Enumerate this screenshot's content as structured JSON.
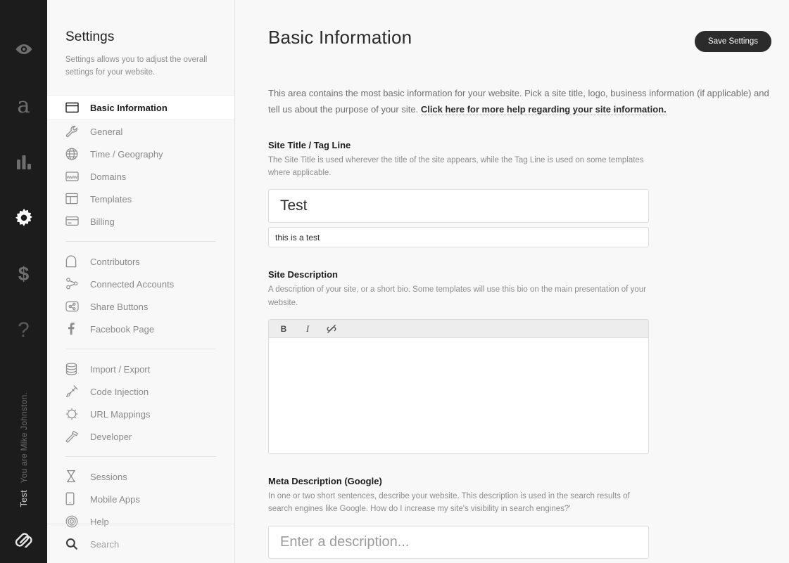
{
  "rail": {
    "top_items": [
      {
        "name": "preview-eye-icon",
        "icon": "eye-icon",
        "active": false
      },
      {
        "name": "design-icon",
        "icon": "letter-a-icon",
        "glyph": "a",
        "active": false
      },
      {
        "name": "metrics-icon",
        "icon": "bar-chart-icon",
        "active": false
      },
      {
        "name": "settings-icon",
        "icon": "gear-icon",
        "active": true
      },
      {
        "name": "commerce-icon",
        "icon": "dollar-icon",
        "glyph": "$",
        "active": false
      },
      {
        "name": "help-icon",
        "icon": "question-mark-icon",
        "glyph": "?",
        "active": false
      }
    ],
    "user_label": "You are Mike Johnston.",
    "site_label": "Test",
    "logo_name": "squarespace-logo"
  },
  "sidebar": {
    "title": "Settings",
    "subtitle": "Settings allows you to adjust the overall settings for your website.",
    "groups": [
      {
        "items": [
          {
            "label": "Basic Information",
            "icon": "window-icon",
            "active": true
          },
          {
            "label": "General",
            "icon": "wrench-icon",
            "active": false
          },
          {
            "label": "Time / Geography",
            "icon": "globe-icon",
            "active": false
          },
          {
            "label": "Domains",
            "icon": "www-icon",
            "active": false
          },
          {
            "label": "Templates",
            "icon": "layout-icon",
            "active": false
          },
          {
            "label": "Billing",
            "icon": "credit-card-icon",
            "active": false
          }
        ]
      },
      {
        "items": [
          {
            "label": "Contributors",
            "icon": "person-icon",
            "active": false
          },
          {
            "label": "Connected Accounts",
            "icon": "nodes-icon",
            "active": false
          },
          {
            "label": "Share Buttons",
            "icon": "share-icon",
            "active": false
          },
          {
            "label": "Facebook Page",
            "icon": "facebook-icon",
            "active": false
          }
        ]
      },
      {
        "items": [
          {
            "label": "Import / Export",
            "icon": "database-icon",
            "active": false
          },
          {
            "label": "Code Injection",
            "icon": "syringe-icon",
            "active": false
          },
          {
            "label": "URL Mappings",
            "icon": "sun-circle-icon",
            "active": false
          },
          {
            "label": "Developer",
            "icon": "hammer-icon",
            "active": false
          }
        ]
      },
      {
        "items": [
          {
            "label": "Sessions",
            "icon": "hourglass-icon",
            "active": false
          },
          {
            "label": "Mobile Apps",
            "icon": "mobile-phone-icon",
            "active": false
          },
          {
            "label": "Help",
            "icon": "lifesaver-icon",
            "active": false
          }
        ]
      }
    ],
    "search_label": "Search"
  },
  "main": {
    "page_title": "Basic Information",
    "save_label": "Save Settings",
    "intro_text": "This area contains the most basic information for your website. Pick a site title, logo, business information (if applicable) and tell us about the purpose of your site. ",
    "intro_link": "Click here for more help regarding your site information.",
    "fields": {
      "site_title": {
        "label": "Site Title / Tag Line",
        "description": "The Site Title is used wherever the title of the site appears, while the Tag Line is used on some templates where applicable.",
        "title_value": "Test",
        "title_placeholder": "",
        "tagline_value": "this is a test",
        "tagline_placeholder": ""
      },
      "site_description": {
        "label": "Site Description",
        "description": "A description of your site, or a short bio. Some templates will use this bio on the main presentation of your website.",
        "toolbar": [
          {
            "name": "bold-button",
            "label": "B"
          },
          {
            "name": "italic-button",
            "label": "I"
          },
          {
            "name": "unlink-button",
            "label": ""
          }
        ],
        "value": "",
        "placeholder": ""
      },
      "meta_description": {
        "label": "Meta Description (Google)",
        "description": "In one or two short sentences, describe your website. This description is used in the search results of search engines like Google. How do I increase my site's visibility in search engines?'",
        "value": "",
        "placeholder": "Enter a description..."
      }
    }
  },
  "colors": {
    "rail_bg": "#1c1c1c",
    "sidebar_bg": "#f8f8f8",
    "main_bg": "#f8f8f8",
    "accent_dark": "#2b2b2b",
    "text_muted": "#8d8d8d"
  }
}
